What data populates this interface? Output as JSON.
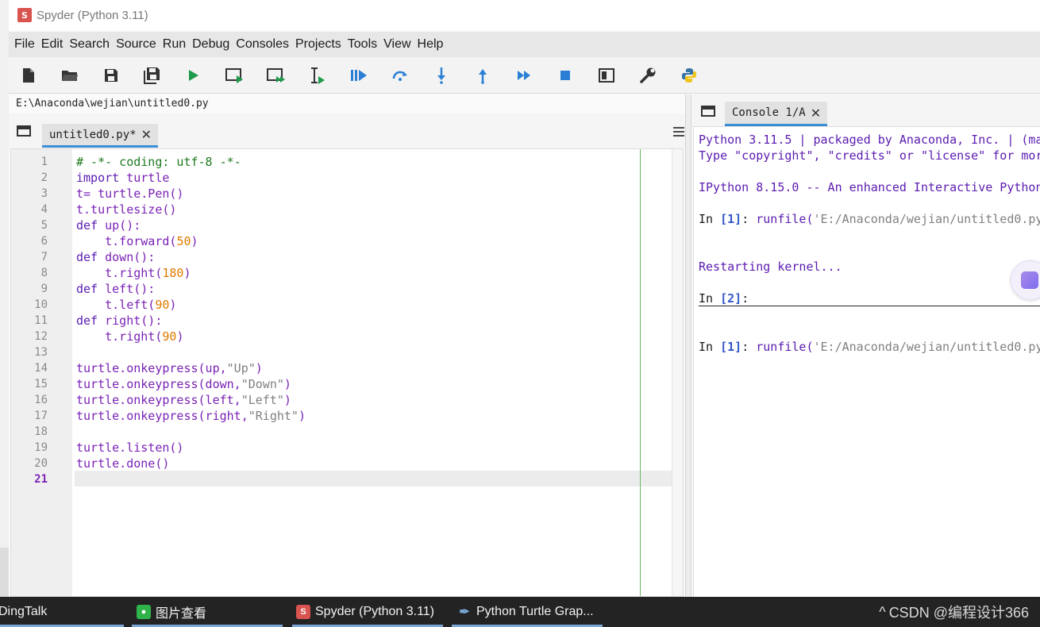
{
  "window": {
    "title": "Spyder (Python 3.11)",
    "app_icon_text": "S"
  },
  "menu": [
    "File",
    "Edit",
    "Search",
    "Source",
    "Run",
    "Debug",
    "Consoles",
    "Projects",
    "Tools",
    "View",
    "Help"
  ],
  "toolbar": {
    "buttons": [
      "new-file",
      "open-file",
      "save-file",
      "save-all",
      "run-file",
      "run-cell",
      "run-cell-advance",
      "run-selection",
      "debug-file",
      "debug-step-over",
      "debug-step-into",
      "debug-step-return",
      "debug-continue",
      "debug-stop",
      "maximize-pane",
      "preferences",
      "python-path-manager"
    ]
  },
  "editor": {
    "path": "E:\\Anaconda\\wejian\\untitled0.py",
    "tab_label": "untitled0.py*",
    "current_line": 21,
    "line_numbers": [
      "1",
      "2",
      "3",
      "4",
      "5",
      "6",
      "7",
      "8",
      "9",
      "10",
      "11",
      "12",
      "13",
      "14",
      "15",
      "16",
      "17",
      "18",
      "19",
      "20",
      "21"
    ]
  },
  "console": {
    "tab_label": "Console 1/A",
    "lines": {
      "banner1": "Python 3.11.5 | packaged by Anaconda, Inc. | (ma",
      "banner2": "Type \"copyright\", \"credits\" or \"license\" for mor",
      "banner3": "IPython 8.15.0 -- An enhanced Interactive Python",
      "restart": "Restarting kernel..."
    },
    "prompt_in": "In",
    "prompt_1": "1",
    "prompt_2": "2",
    "runfile_call": "runfile(",
    "runfile_arg": "'E:/Anaconda/wejian/untitled0.py"
  },
  "taskbar": {
    "items": [
      {
        "label": "DingTalk"
      },
      {
        "label": "图片查看"
      },
      {
        "label": "Spyder (Python 3.11)"
      },
      {
        "label": "Python Turtle Grap..."
      }
    ],
    "tray_text": "CSDN @编程设计366",
    "tray_chevron": "^"
  },
  "colors": {
    "accent": "#3a8ed6",
    "keyword": "#5a1bb0",
    "comment": "#1f7a1f",
    "number": "#e07a00",
    "string": "#7f7f7f"
  }
}
